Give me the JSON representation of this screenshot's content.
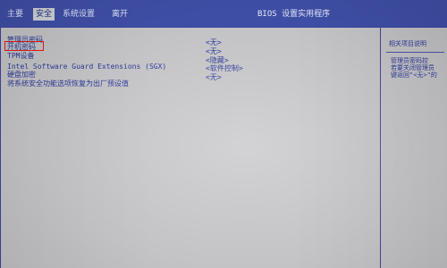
{
  "topbar": {
    "menu": [
      "主要",
      "安全",
      "系统设置",
      "离开"
    ],
    "active_index": 1,
    "title": "BIOS 设置实用程序"
  },
  "settings": [
    {
      "label": "管理员密码",
      "value": "<无>"
    },
    {
      "label": "开机密码",
      "value": "<无>"
    },
    {
      "label": "TPM设备",
      "value": "<隐藏>"
    },
    {
      "label": "Intel Software Guard Extensions (SGX)",
      "value": "<软件控制>"
    },
    {
      "label": "硬盘加密",
      "value": "<无>"
    },
    {
      "label": "将系统安全功能选项恢复为出厂预设值",
      "value": ""
    }
  ],
  "selected_index": 1,
  "help": {
    "title": "相关项目说明",
    "lines": [
      "管理员密码控",
      "若要关闭管理员",
      "键返回\"<无>\"的"
    ]
  },
  "colors": {
    "topbar_bg": "#3f4fa7",
    "content_bg": "#c4c4c7",
    "text": "#2c3897",
    "highlight_border": "#e31b1b"
  },
  "icons": {
    "setting_marker": "none"
  }
}
